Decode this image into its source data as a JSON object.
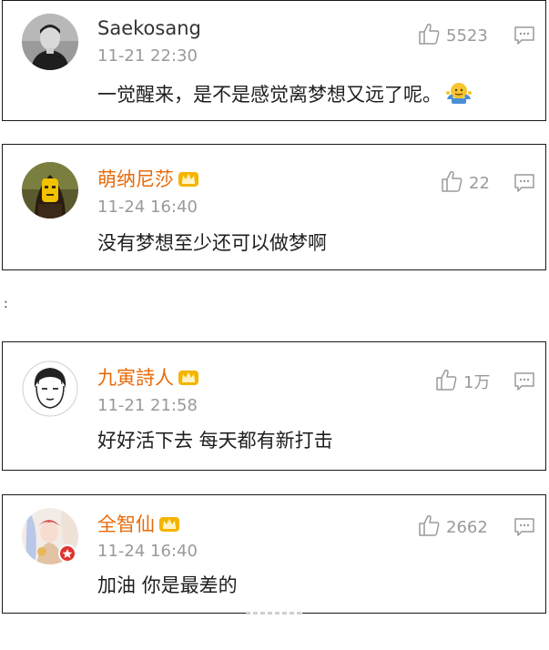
{
  "comments": [
    {
      "username": "Saekosang",
      "vip": false,
      "time": "11-21 22:30",
      "text": "一觉醒来，是不是感觉离梦想又远了呢。",
      "emoji": "shrug-emoji",
      "likes": "5523"
    },
    {
      "username": "萌纳尼莎",
      "vip": true,
      "time": "11-24 16:40",
      "text": "没有梦想至少还可以做梦啊",
      "likes": "22"
    },
    {
      "username": "九寅詩人",
      "vip": true,
      "time": "11-21 21:58",
      "text": "好好活下去 每天都有新打击",
      "likes": "1万"
    },
    {
      "username": "全智仙",
      "vip": true,
      "time": "11-24 16:40",
      "text": "加油 你是最差的",
      "likes": "2662"
    }
  ],
  "separator_text": ":",
  "icons": {
    "like": "thumbs-up-icon",
    "reply": "comment-icon",
    "vip_badge": "crown-icon"
  },
  "colors": {
    "vip_name": "#e86b0a",
    "meta_gray": "#9a9a9a",
    "border": "#1a1a1a"
  }
}
